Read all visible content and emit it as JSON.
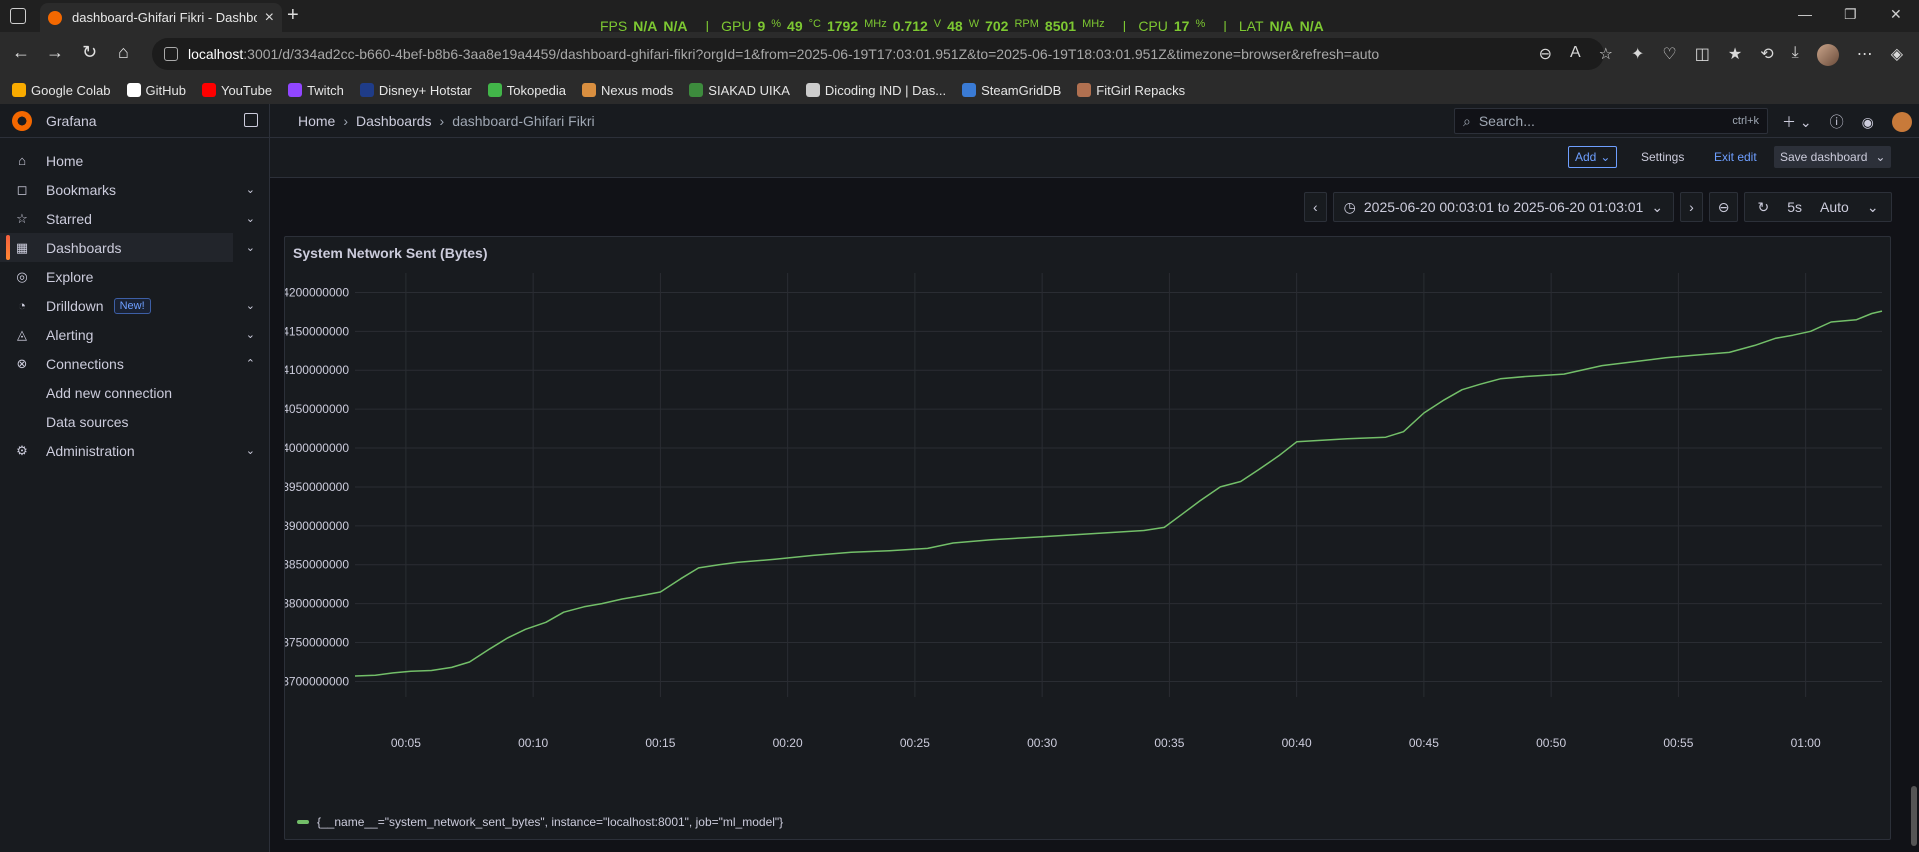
{
  "browser": {
    "tab_title": "dashboard-Ghifari Fikri - Dashboa",
    "url_host": "localhost",
    "url_path": ":3001/d/334ad2cc-b660-4bef-b8b6-3aa8e19a4459/dashboard-ghifari-fikri?orgId=1&from=2025-06-19T17:03:01.951Z&to=2025-06-19T18:03:01.951Z&timezone=browser&refresh=auto",
    "hud": {
      "fps_label": "FPS",
      "fps_a": "N/A",
      "fps_b": "N/A",
      "gpu_label": "GPU",
      "gpu_load": "9",
      "gpu_load_unit": "%",
      "gpu_temp": "49",
      "gpu_temp_unit": "°C",
      "gpu_clock": "1792",
      "gpu_clock_unit": "MHz",
      "gpu_volt": "0.712",
      "gpu_volt_unit": "V",
      "gpu_watt": "48",
      "gpu_watt_unit": "W",
      "gpu_rpm": "702",
      "gpu_rpm_unit": "RPM",
      "gpu_mem": "8501",
      "gpu_mem_unit": "MHz",
      "cpu_label": "CPU",
      "cpu_load": "17",
      "cpu_unit": "%",
      "lat_label": "LAT",
      "lat_a": "N/A",
      "lat_b": "N/A"
    },
    "bookmarks": [
      {
        "label": "Google Colab",
        "color": "#f9ab00"
      },
      {
        "label": "GitHub",
        "color": "#ffffff"
      },
      {
        "label": "YouTube",
        "color": "#ff0000"
      },
      {
        "label": "Twitch",
        "color": "#9146ff"
      },
      {
        "label": "Disney+ Hotstar",
        "color": "#1f3c88"
      },
      {
        "label": "Tokopedia",
        "color": "#42b549"
      },
      {
        "label": "Nexus mods",
        "color": "#d98f40"
      },
      {
        "label": "SIAKAD UIKA",
        "color": "#3d8b3d"
      },
      {
        "label": "Dicoding IND | Das...",
        "color": "#cccccc"
      },
      {
        "label": "SteamGridDB",
        "color": "#3a7bd5"
      },
      {
        "label": "FitGirl Repacks",
        "color": "#b07050"
      }
    ]
  },
  "grafana": {
    "brand": "Grafana",
    "menu": [
      {
        "label": "Home",
        "icon": "home-icon",
        "glyph": "⌂",
        "chev": ""
      },
      {
        "label": "Bookmarks",
        "icon": "bookmark-icon",
        "glyph": "◻",
        "chev": "⌄"
      },
      {
        "label": "Starred",
        "icon": "star-icon",
        "glyph": "☆",
        "chev": "⌄"
      },
      {
        "label": "Dashboards",
        "icon": "dashboards-icon",
        "glyph": "▦",
        "chev": "⌄",
        "active": true
      },
      {
        "label": "Explore",
        "icon": "compass-icon",
        "glyph": "◎",
        "chev": ""
      },
      {
        "label": "Drilldown",
        "icon": "drilldown-icon",
        "glyph": "◔",
        "chev": "⌄",
        "badge": "New!"
      },
      {
        "label": "Alerting",
        "icon": "bell-icon",
        "glyph": "◬",
        "chev": "⌄"
      },
      {
        "label": "Connections",
        "icon": "connections-icon",
        "glyph": "⊗",
        "chev": "⌃"
      },
      {
        "label": "Add new connection",
        "sub": true
      },
      {
        "label": "Data sources",
        "sub": true
      },
      {
        "label": "Administration",
        "icon": "gear-icon",
        "glyph": "⚙",
        "chev": "⌄"
      }
    ],
    "breadcrumbs": [
      "Home",
      "Dashboards",
      "dashboard-Ghifari Fikri"
    ],
    "search_placeholder": "Search...",
    "search_shortcut": "ctrl+k",
    "editbar": {
      "add": "Add",
      "settings": "Settings",
      "exit": "Exit edit",
      "save": "Save dashboard"
    },
    "timerange": "2025-06-20 00:03:01 to 2025-06-20 01:03:01",
    "refresh_interval": "5s",
    "refresh_mode": "Auto",
    "panel_title": "System Network Sent (Bytes)",
    "legend": "{__name__=\"system_network_sent_bytes\", instance=\"localhost:8001\", job=\"ml_model\"}"
  },
  "chart_data": {
    "type": "line",
    "title": "System Network Sent (Bytes)",
    "x_unit": "minutes after 00:00",
    "ylim": [
      3680000000,
      4225000000
    ],
    "xlim": [
      3,
      63
    ],
    "y_ticks": [
      3700000000,
      3750000000,
      3800000000,
      3850000000,
      3900000000,
      3950000000,
      4000000000,
      4050000000,
      4100000000,
      4150000000,
      4200000000
    ],
    "x_ticks": [
      "00:05",
      "00:10",
      "00:15",
      "00:20",
      "00:25",
      "00:30",
      "00:35",
      "00:40",
      "00:45",
      "00:50",
      "00:55",
      "01:00"
    ],
    "grid": true,
    "series": [
      {
        "name": "{__name__=\"system_network_sent_bytes\", instance=\"localhost:8001\", job=\"ml_model\"}",
        "color": "#73bf69",
        "x": [
          3.0,
          3.8,
          4.5,
          5.2,
          6.0,
          6.8,
          7.5,
          8.3,
          9.0,
          9.7,
          10.5,
          11.2,
          12.0,
          12.7,
          13.5,
          14.2,
          15.0,
          15.8,
          16.5,
          17.3,
          18.0,
          19.5,
          21.0,
          22.5,
          24.0,
          25.5,
          26.5,
          28.0,
          30.0,
          32.0,
          34.0,
          34.8,
          35.5,
          36.2,
          37.0,
          37.8,
          38.5,
          39.3,
          40.0,
          41.0,
          42.0,
          43.5,
          44.2,
          45.0,
          45.8,
          46.5,
          47.2,
          48.0,
          49.0,
          50.5,
          52.0,
          53.0,
          54.5,
          55.5,
          57.0,
          58.0,
          58.8,
          59.5,
          60.2,
          61.0,
          62.0,
          62.6,
          63.0
        ],
        "y": [
          3707000000,
          3708000000,
          3711000000,
          3713000000,
          3714000000,
          3718000000,
          3725000000,
          3742000000,
          3756000000,
          3767000000,
          3776000000,
          3789000000,
          3796000000,
          3800000000,
          3806000000,
          3810000000,
          3815000000,
          3832000000,
          3846000000,
          3850000000,
          3853000000,
          3857000000,
          3862000000,
          3866000000,
          3868000000,
          3871000000,
          3878000000,
          3882000000,
          3886000000,
          3890000000,
          3894000000,
          3898000000,
          3915000000,
          3932000000,
          3950000000,
          3957000000,
          3972000000,
          3990000000,
          4008000000,
          4010000000,
          4012000000,
          4014000000,
          4021000000,
          4045000000,
          4062000000,
          4075000000,
          4082000000,
          4089000000,
          4092000000,
          4095000000,
          4106000000,
          4110000000,
          4116000000,
          4119000000,
          4123000000,
          4132000000,
          4141000000,
          4145000000,
          4150000000,
          4162000000,
          4165000000,
          4173000000,
          4176000000
        ]
      }
    ]
  }
}
